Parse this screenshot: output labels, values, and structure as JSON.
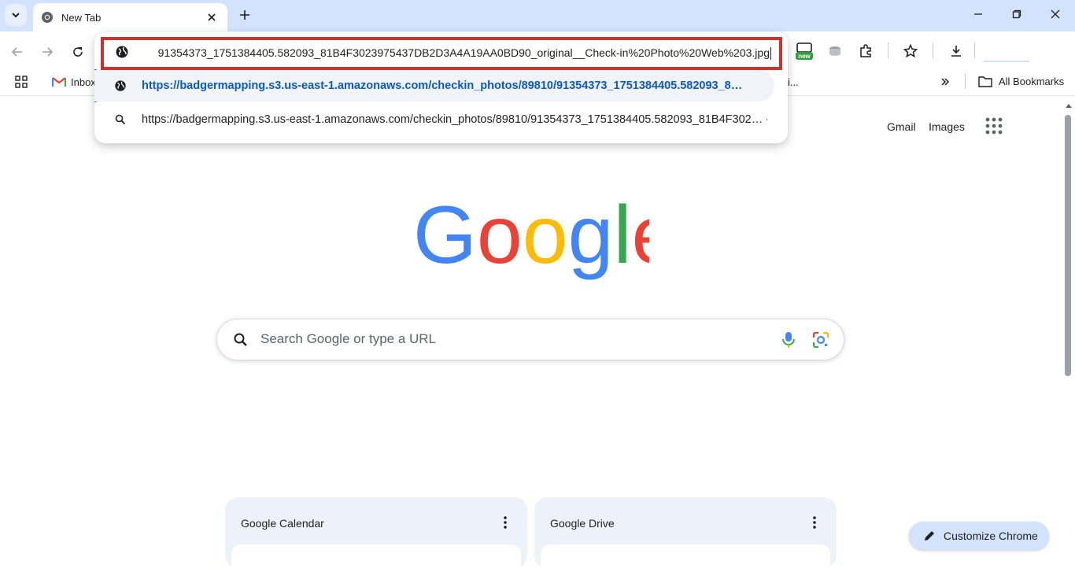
{
  "tabstrip": {
    "tab_title": "New Tab"
  },
  "omnibox": {
    "input_value": "91354373_1751384405.582093_81B4F3023975437DB2D3A4A19AA0BD90_original__Check-in%20Photo%20Web%203.jpg",
    "suggestions": [
      {
        "icon": "globe-icon",
        "text": "https://badgermapping.s3.us-east-1.amazonaws.com/checkin_photos/89810/91354373_1751384405.582093_8…",
        "selected": true
      },
      {
        "icon": "search-icon",
        "text": "https://badgermapping.s3.us-east-1.amazonaws.com/checkin_photos/89810/91354373_1751384405.582093_81B4F302… -",
        "selected": false
      }
    ]
  },
  "bookmarks": {
    "items": [
      "Inbox",
      "i..."
    ],
    "all_label": "All Bookmarks"
  },
  "extensions": {
    "badge_label": "new"
  },
  "page": {
    "top_links": [
      "Gmail",
      "Images"
    ],
    "search_placeholder": "Search Google or type a URL",
    "cards": [
      {
        "title": "Google Calendar"
      },
      {
        "title": "Google Drive"
      }
    ],
    "customize_label": "Customize Chrome"
  },
  "colors": {
    "accent": "#0b57d0",
    "highlight_border": "#d32f2f",
    "tabstrip": "#d3e3fd"
  }
}
